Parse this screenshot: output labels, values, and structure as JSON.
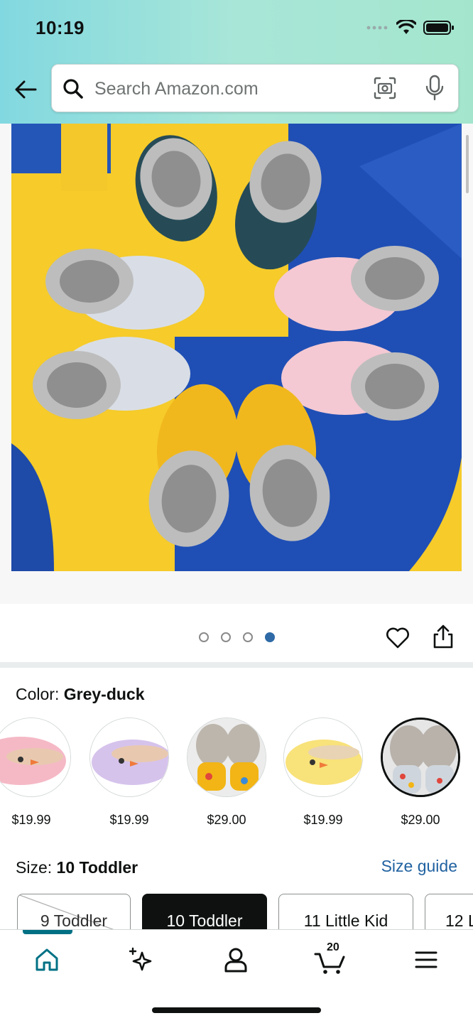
{
  "status_bar": {
    "time": "10:19"
  },
  "search": {
    "placeholder": "Search Amazon.com"
  },
  "gallery": {
    "dots_total": 4,
    "active_dot": 4
  },
  "color": {
    "label": "Color:",
    "selected": "Grey-duck"
  },
  "swatches": [
    {
      "price": "$19.99",
      "name": "pink-swatch"
    },
    {
      "price": "$19.99",
      "name": "purple-swatch"
    },
    {
      "price": "$29.00",
      "name": "yellow-print-swatch"
    },
    {
      "price": "$19.99",
      "name": "yellow-swatch"
    },
    {
      "price": "$29.00",
      "name": "grey-duck-swatch"
    }
  ],
  "size": {
    "label": "Size:",
    "selected": "10 Toddler",
    "guide": "Size guide"
  },
  "size_chips": [
    "9 Toddler",
    "10 Toddler",
    "11 Little Kid",
    "12 L"
  ],
  "nav": {
    "cart_count": "20"
  },
  "colors": {
    "accent": "#007185",
    "link": "#2162a1",
    "dot_active": "#2f6aa6"
  }
}
